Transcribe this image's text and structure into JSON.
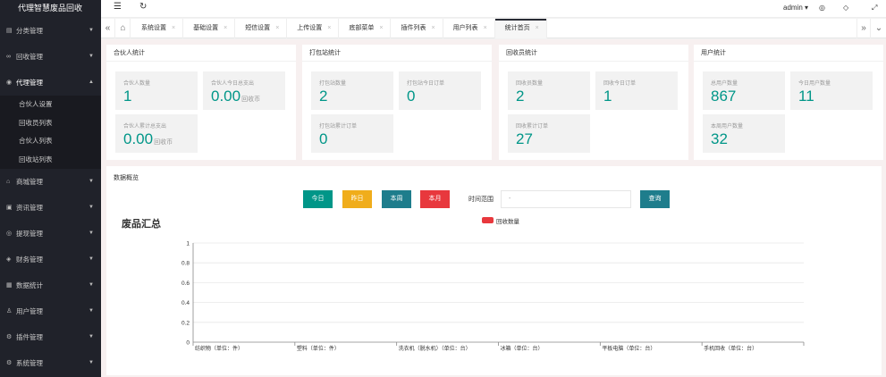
{
  "app": {
    "title": "代理智慧废品回收"
  },
  "sidebar": {
    "items": [
      {
        "label": "分类管理",
        "icon": "category-icon"
      },
      {
        "label": "回收管理",
        "icon": "recycle-icon"
      },
      {
        "label": "代理管理",
        "icon": "agent-icon",
        "open": true,
        "children": [
          "合伙人设置",
          "回收员列表",
          "合伙人列表",
          "回收站列表"
        ]
      },
      {
        "label": "商城管理",
        "icon": "cart-icon"
      },
      {
        "label": "资讯管理",
        "icon": "news-icon"
      },
      {
        "label": "提现管理",
        "icon": "withdraw-icon"
      },
      {
        "label": "财务管理",
        "icon": "finance-icon"
      },
      {
        "label": "数据统计",
        "icon": "stats-icon"
      },
      {
        "label": "用户管理",
        "icon": "user-icon"
      },
      {
        "label": "插件管理",
        "icon": "plugin-icon"
      },
      {
        "label": "系统管理",
        "icon": "system-icon"
      }
    ]
  },
  "header": {
    "user": "admin ▾"
  },
  "tabs": [
    {
      "label": "系统设置"
    },
    {
      "label": "基础设置"
    },
    {
      "label": "短信设置"
    },
    {
      "label": "上传设置"
    },
    {
      "label": "底部菜单"
    },
    {
      "label": "插件列表"
    },
    {
      "label": "用户列表"
    },
    {
      "label": "统计首页",
      "active": true
    }
  ],
  "cards": [
    {
      "title": "合伙人统计",
      "stats": [
        {
          "label": "合伙人数量",
          "value": "1",
          "unit": ""
        },
        {
          "label": "合伙人今日总支出",
          "value": "0.00",
          "unit": "回收币"
        },
        {
          "label": "合伙人累计总支出",
          "value": "0.00",
          "unit": "回收币"
        }
      ]
    },
    {
      "title": "打包站统计",
      "stats": [
        {
          "label": "打包站数量",
          "value": "2",
          "unit": ""
        },
        {
          "label": "打包站今日订单",
          "value": "0",
          "unit": ""
        },
        {
          "label": "打包站累计订单",
          "value": "0",
          "unit": ""
        }
      ]
    },
    {
      "title": "回收员统计",
      "stats": [
        {
          "label": "回收员数量",
          "value": "2",
          "unit": ""
        },
        {
          "label": "回收今日订单",
          "value": "1",
          "unit": ""
        },
        {
          "label": "回收累计订单",
          "value": "27",
          "unit": ""
        }
      ]
    },
    {
      "title": "用户统计",
      "stats": [
        {
          "label": "总用户数量",
          "value": "867",
          "unit": ""
        },
        {
          "label": "今日用户数量",
          "value": "11",
          "unit": ""
        },
        {
          "label": "本周用户数量",
          "value": "32",
          "unit": ""
        }
      ]
    }
  ],
  "overview": {
    "title": "数据概览",
    "buttons": [
      {
        "label": "今日",
        "color": "#009688"
      },
      {
        "label": "昨日",
        "color": "#f0ad1b"
      },
      {
        "label": "本周",
        "color": "#1e7d8c"
      },
      {
        "label": "本月",
        "color": "#e8383d"
      }
    ],
    "range_label": "时间范围",
    "range_value": "-",
    "query_label": "查询",
    "query_color": "#1e7d8c"
  },
  "chart_data": {
    "type": "bar",
    "title": "废品汇总",
    "categories": [
      "纺织物（单位：件）",
      "塑料（单位：件）",
      "洗衣机（脱水机）（单位：台）",
      "冰箱（单位：台）",
      "平板电脑（单位：台）",
      "手机回收（单位：台）"
    ],
    "series": [
      {
        "name": "回收数量",
        "values": [
          0,
          0,
          0,
          0,
          0,
          0
        ],
        "color": "#e8383d"
      }
    ],
    "yticks": [
      "0",
      "0.2",
      "0.4",
      "0.6",
      "0.8",
      "1"
    ],
    "ylim": [
      0,
      1
    ],
    "grid": true,
    "legend": "top-center"
  }
}
